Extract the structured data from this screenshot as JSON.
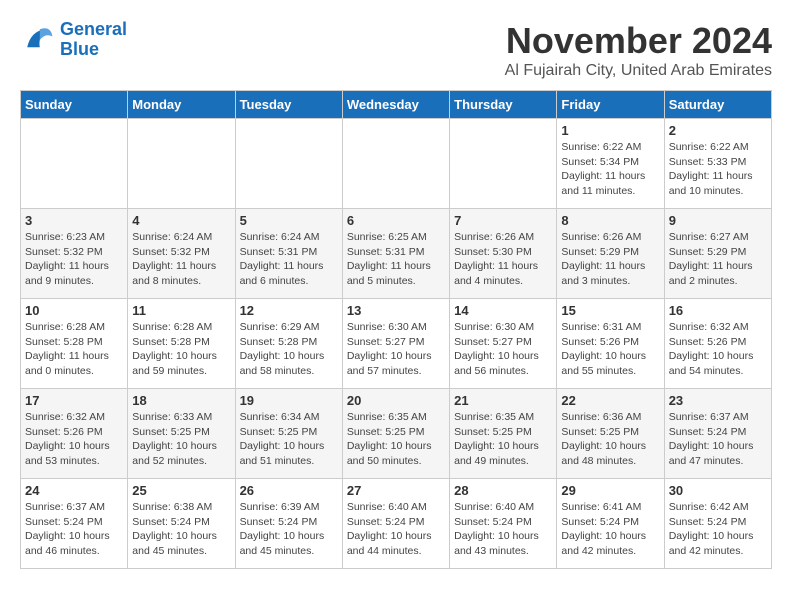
{
  "header": {
    "logo": {
      "line1": "General",
      "line2": "Blue"
    },
    "title": "November 2024",
    "location": "Al Fujairah City, United Arab Emirates"
  },
  "columns": [
    "Sunday",
    "Monday",
    "Tuesday",
    "Wednesday",
    "Thursday",
    "Friday",
    "Saturday"
  ],
  "weeks": [
    [
      {
        "day": "",
        "info": ""
      },
      {
        "day": "",
        "info": ""
      },
      {
        "day": "",
        "info": ""
      },
      {
        "day": "",
        "info": ""
      },
      {
        "day": "",
        "info": ""
      },
      {
        "day": "1",
        "info": "Sunrise: 6:22 AM\nSunset: 5:34 PM\nDaylight: 11 hours and 11 minutes."
      },
      {
        "day": "2",
        "info": "Sunrise: 6:22 AM\nSunset: 5:33 PM\nDaylight: 11 hours and 10 minutes."
      }
    ],
    [
      {
        "day": "3",
        "info": "Sunrise: 6:23 AM\nSunset: 5:32 PM\nDaylight: 11 hours and 9 minutes."
      },
      {
        "day": "4",
        "info": "Sunrise: 6:24 AM\nSunset: 5:32 PM\nDaylight: 11 hours and 8 minutes."
      },
      {
        "day": "5",
        "info": "Sunrise: 6:24 AM\nSunset: 5:31 PM\nDaylight: 11 hours and 6 minutes."
      },
      {
        "day": "6",
        "info": "Sunrise: 6:25 AM\nSunset: 5:31 PM\nDaylight: 11 hours and 5 minutes."
      },
      {
        "day": "7",
        "info": "Sunrise: 6:26 AM\nSunset: 5:30 PM\nDaylight: 11 hours and 4 minutes."
      },
      {
        "day": "8",
        "info": "Sunrise: 6:26 AM\nSunset: 5:29 PM\nDaylight: 11 hours and 3 minutes."
      },
      {
        "day": "9",
        "info": "Sunrise: 6:27 AM\nSunset: 5:29 PM\nDaylight: 11 hours and 2 minutes."
      }
    ],
    [
      {
        "day": "10",
        "info": "Sunrise: 6:28 AM\nSunset: 5:28 PM\nDaylight: 11 hours and 0 minutes."
      },
      {
        "day": "11",
        "info": "Sunrise: 6:28 AM\nSunset: 5:28 PM\nDaylight: 10 hours and 59 minutes."
      },
      {
        "day": "12",
        "info": "Sunrise: 6:29 AM\nSunset: 5:28 PM\nDaylight: 10 hours and 58 minutes."
      },
      {
        "day": "13",
        "info": "Sunrise: 6:30 AM\nSunset: 5:27 PM\nDaylight: 10 hours and 57 minutes."
      },
      {
        "day": "14",
        "info": "Sunrise: 6:30 AM\nSunset: 5:27 PM\nDaylight: 10 hours and 56 minutes."
      },
      {
        "day": "15",
        "info": "Sunrise: 6:31 AM\nSunset: 5:26 PM\nDaylight: 10 hours and 55 minutes."
      },
      {
        "day": "16",
        "info": "Sunrise: 6:32 AM\nSunset: 5:26 PM\nDaylight: 10 hours and 54 minutes."
      }
    ],
    [
      {
        "day": "17",
        "info": "Sunrise: 6:32 AM\nSunset: 5:26 PM\nDaylight: 10 hours and 53 minutes."
      },
      {
        "day": "18",
        "info": "Sunrise: 6:33 AM\nSunset: 5:25 PM\nDaylight: 10 hours and 52 minutes."
      },
      {
        "day": "19",
        "info": "Sunrise: 6:34 AM\nSunset: 5:25 PM\nDaylight: 10 hours and 51 minutes."
      },
      {
        "day": "20",
        "info": "Sunrise: 6:35 AM\nSunset: 5:25 PM\nDaylight: 10 hours and 50 minutes."
      },
      {
        "day": "21",
        "info": "Sunrise: 6:35 AM\nSunset: 5:25 PM\nDaylight: 10 hours and 49 minutes."
      },
      {
        "day": "22",
        "info": "Sunrise: 6:36 AM\nSunset: 5:25 PM\nDaylight: 10 hours and 48 minutes."
      },
      {
        "day": "23",
        "info": "Sunrise: 6:37 AM\nSunset: 5:24 PM\nDaylight: 10 hours and 47 minutes."
      }
    ],
    [
      {
        "day": "24",
        "info": "Sunrise: 6:37 AM\nSunset: 5:24 PM\nDaylight: 10 hours and 46 minutes."
      },
      {
        "day": "25",
        "info": "Sunrise: 6:38 AM\nSunset: 5:24 PM\nDaylight: 10 hours and 45 minutes."
      },
      {
        "day": "26",
        "info": "Sunrise: 6:39 AM\nSunset: 5:24 PM\nDaylight: 10 hours and 45 minutes."
      },
      {
        "day": "27",
        "info": "Sunrise: 6:40 AM\nSunset: 5:24 PM\nDaylight: 10 hours and 44 minutes."
      },
      {
        "day": "28",
        "info": "Sunrise: 6:40 AM\nSunset: 5:24 PM\nDaylight: 10 hours and 43 minutes."
      },
      {
        "day": "29",
        "info": "Sunrise: 6:41 AM\nSunset: 5:24 PM\nDaylight: 10 hours and 42 minutes."
      },
      {
        "day": "30",
        "info": "Sunrise: 6:42 AM\nSunset: 5:24 PM\nDaylight: 10 hours and 42 minutes."
      }
    ]
  ]
}
